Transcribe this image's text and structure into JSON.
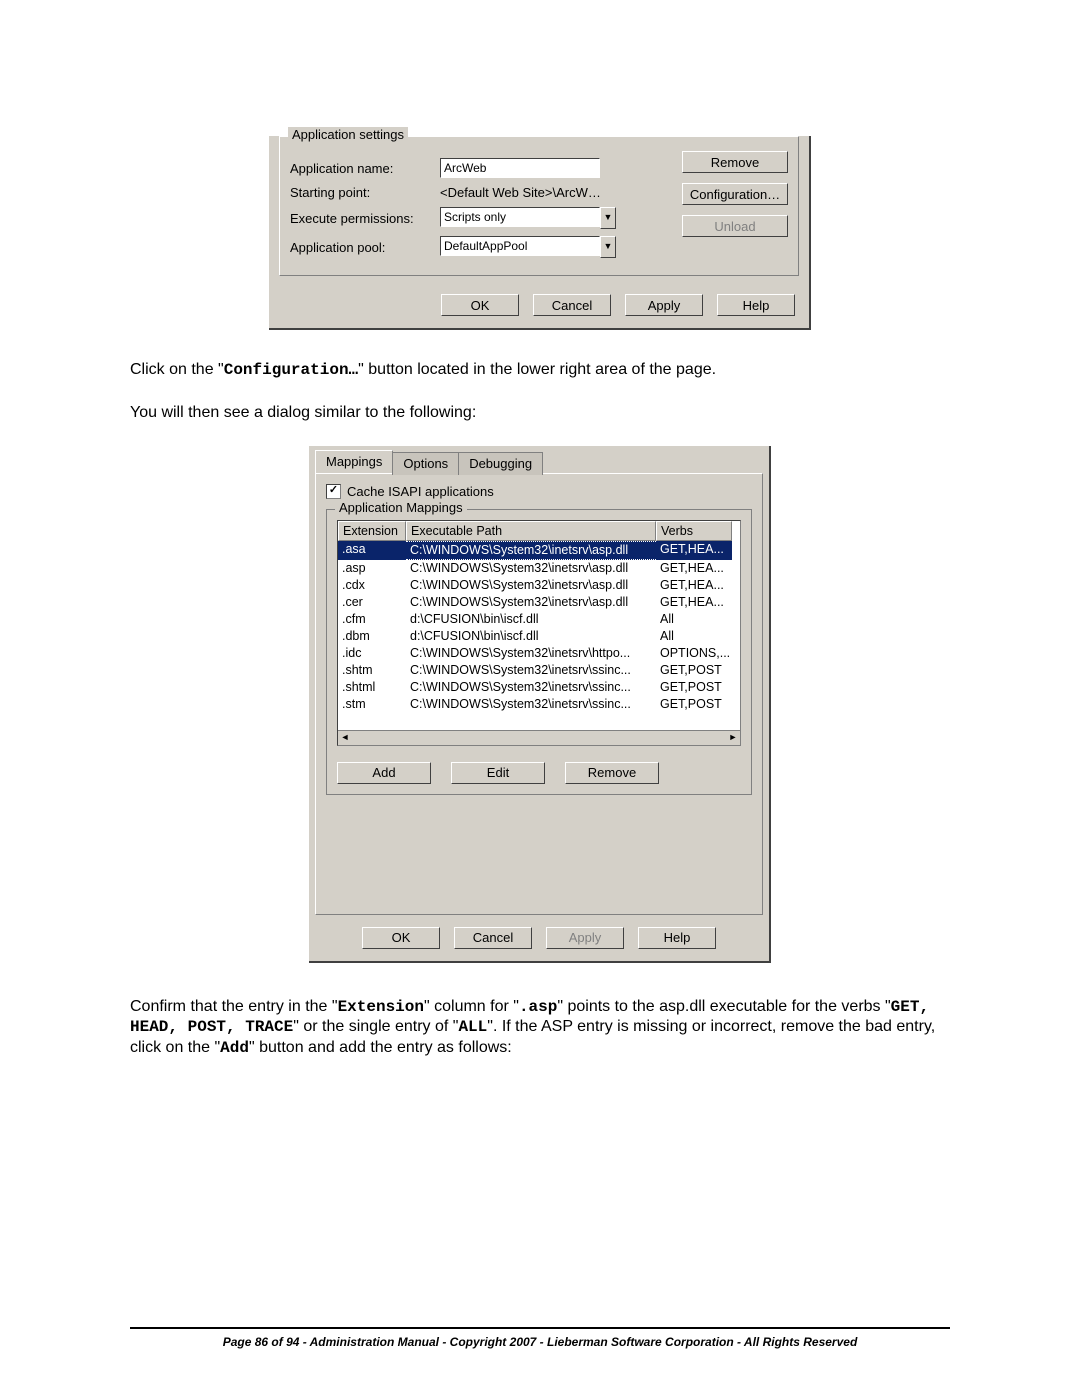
{
  "dlg1": {
    "group_title": "Application settings",
    "rows": {
      "name_label": "Application name:",
      "name_value": "ArcWeb",
      "start_label": "Starting point:",
      "start_value": "<Default Web Site>\\ArcW…",
      "exec_label": "Execute permissions:",
      "exec_value": "Scripts only",
      "pool_label": "Application pool:",
      "pool_value": "DefaultAppPool"
    },
    "side_buttons": {
      "remove": "Remove",
      "config": "Configuration…",
      "unload": "Unload"
    },
    "bottom": {
      "ok": "OK",
      "cancel": "Cancel",
      "apply": "Apply",
      "help": "Help"
    }
  },
  "para1_pre": "Click on the \"",
  "para1_mono": "Configuration…",
  "para1_post": "\" button located in the lower right area of the page.",
  "para2": "You will then see a dialog similar to the following:",
  "dlg2": {
    "tabs": {
      "t1": "Mappings",
      "t2": "Options",
      "t3": "Debugging"
    },
    "cache_label": "Cache ISAPI applications",
    "fs_title": "Application Mappings",
    "cols": {
      "c1": "Extension",
      "c2": "Executable Path",
      "c3": "Verbs"
    },
    "rows": [
      {
        "ext": ".asa",
        "path": "C:\\WINDOWS\\System32\\inetsrv\\asp.dll",
        "verbs": "GET,HEA...",
        "sel": true
      },
      {
        "ext": ".asp",
        "path": "C:\\WINDOWS\\System32\\inetsrv\\asp.dll",
        "verbs": "GET,HEA..."
      },
      {
        "ext": ".cdx",
        "path": "C:\\WINDOWS\\System32\\inetsrv\\asp.dll",
        "verbs": "GET,HEA..."
      },
      {
        "ext": ".cer",
        "path": "C:\\WINDOWS\\System32\\inetsrv\\asp.dll",
        "verbs": "GET,HEA..."
      },
      {
        "ext": ".cfm",
        "path": "d:\\CFUSION\\bin\\iscf.dll",
        "verbs": "All"
      },
      {
        "ext": ".dbm",
        "path": "d:\\CFUSION\\bin\\iscf.dll",
        "verbs": "All"
      },
      {
        "ext": ".idc",
        "path": "C:\\WINDOWS\\System32\\inetsrv\\httpo...",
        "verbs": "OPTIONS,..."
      },
      {
        "ext": ".shtm",
        "path": "C:\\WINDOWS\\System32\\inetsrv\\ssinc...",
        "verbs": "GET,POST"
      },
      {
        "ext": ".shtml",
        "path": "C:\\WINDOWS\\System32\\inetsrv\\ssinc...",
        "verbs": "GET,POST"
      },
      {
        "ext": ".stm",
        "path": "C:\\WINDOWS\\System32\\inetsrv\\ssinc...",
        "verbs": "GET,POST"
      }
    ],
    "btns": {
      "add": "Add",
      "edit": "Edit",
      "remove": "Remove"
    },
    "bottom": {
      "ok": "OK",
      "cancel": "Cancel",
      "apply": "Apply",
      "help": "Help"
    }
  },
  "para3": {
    "s1": "Confirm that the entry in the \"",
    "m1": "Extension",
    "s2": "\" column for \"",
    "m2": ".asp",
    "s3": "\" points to the asp.dll executable for the verbs \"",
    "m3": "GET, HEAD, POST, TRACE",
    "s4": "\" or the single entry of \"",
    "m4": "ALL",
    "s5": "\".  If the ASP entry is missing or incorrect, remove the bad entry, click on the \"",
    "m5": "Add",
    "s6": "\" button and add the entry as follows:"
  },
  "footer": "Page 86 of 94 - Administration Manual - Copyright 2007 - Lieberman Software Corporation - All Rights Reserved"
}
